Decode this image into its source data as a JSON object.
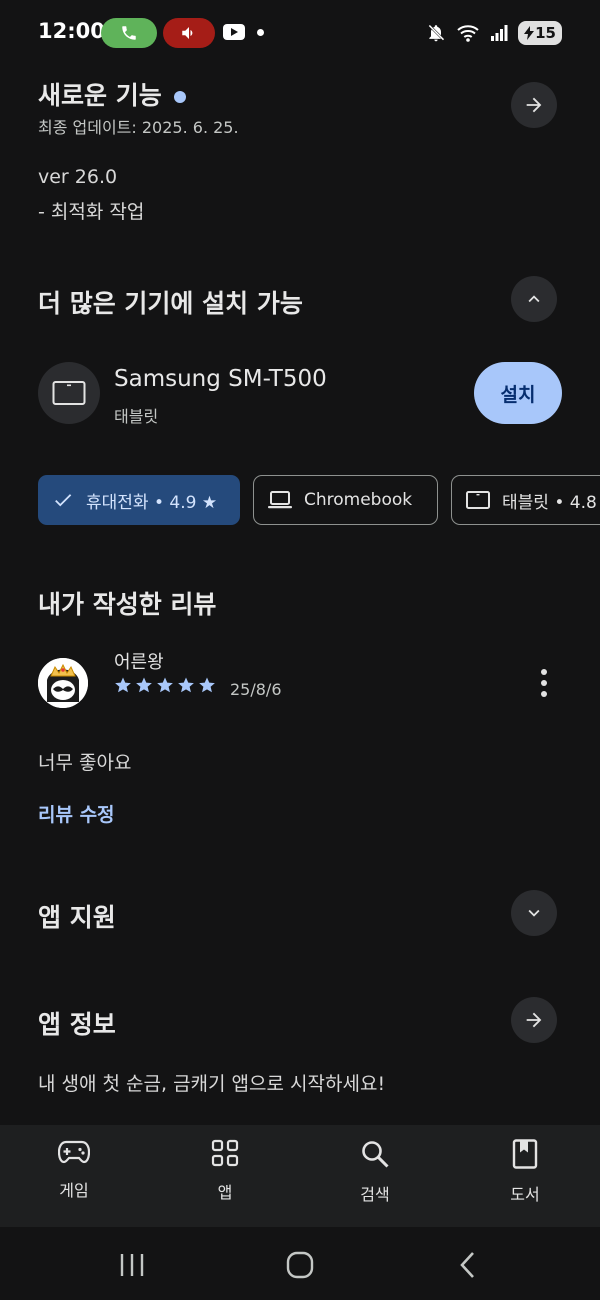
{
  "status_bar": {
    "time": "12:00",
    "battery": "15",
    "icons": [
      "phone-icon",
      "speaker-icon",
      "youtube-icon",
      "notification-dot-icon",
      "mute-icon",
      "wifi-icon",
      "signal-icon",
      "battery-icon"
    ]
  },
  "whats_new": {
    "title": "새로운 기능",
    "updated": "최종 업데이트: 2025. 6. 25.",
    "version": "ver 26.0",
    "note": "- 최적화 작업"
  },
  "devices": {
    "title": "더 많은 기기에 설치 가능",
    "device_name": "Samsung SM-T500",
    "device_type": "태블릿",
    "install_label": "설치",
    "chips": [
      {
        "label": "휴대전화 • 4.9 ★",
        "selected": true
      },
      {
        "label": "Chromebook",
        "selected": false
      },
      {
        "label": "태블릿 • 4.8",
        "selected": false
      }
    ]
  },
  "my_review": {
    "title": "내가 작성한 리뷰",
    "reviewer": "어른왕",
    "rating": 5,
    "date": "25/8/6",
    "text": "너무 좋아요",
    "edit_label": "리뷰 수정"
  },
  "app_support": {
    "title": "앱 지원"
  },
  "app_info": {
    "title": "앱 정보",
    "description": "내 생애 첫 순금, 금캐기 앱으로 시작하세요!"
  },
  "bottom_nav": [
    {
      "label": "게임",
      "icon": "gamepad-icon"
    },
    {
      "label": "앱",
      "icon": "apps-grid-icon"
    },
    {
      "label": "검색",
      "icon": "search-icon"
    },
    {
      "label": "도서",
      "icon": "book-icon"
    }
  ],
  "colors": {
    "background": "#131314",
    "accent": "#a8c7fa",
    "chip_selected": "#254a7c",
    "nav_background": "#1e1f20"
  }
}
